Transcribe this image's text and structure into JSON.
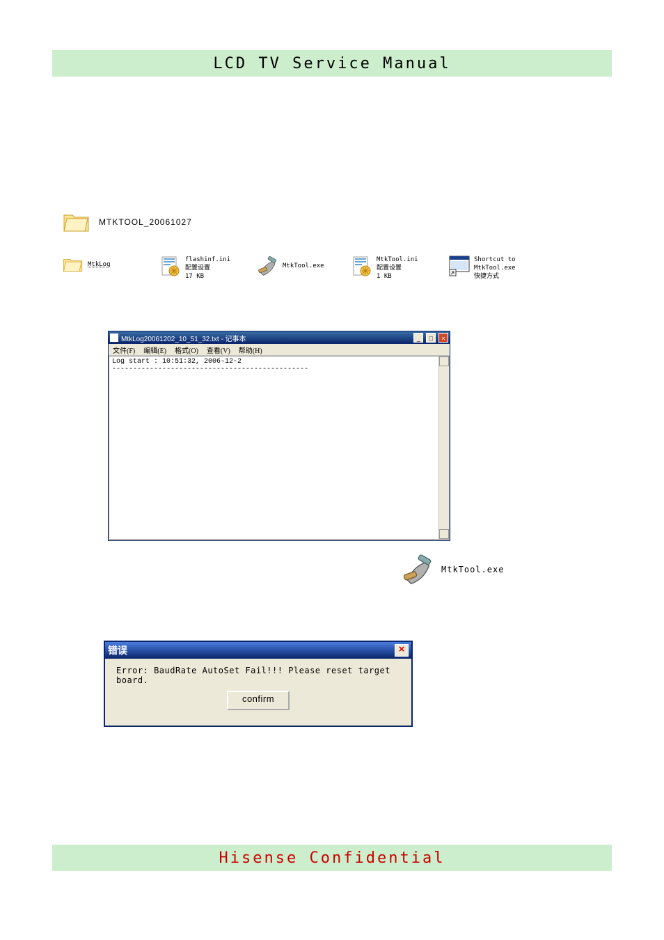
{
  "header": {
    "title": "LCD TV Service Manual"
  },
  "footer": {
    "text": "Hisense Confidential"
  },
  "folder_row": {
    "folder_name": "MTKTOOL_20061027"
  },
  "icons": {
    "mtklog": {
      "name": "MtkLog"
    },
    "flashinf": {
      "line1": "flashinf.ini",
      "line2": "配置设置",
      "line3": "17 KB"
    },
    "mtktool_exe": {
      "name": "MtkTool.exe"
    },
    "mtktool_ini": {
      "line1": "MtkTool.ini",
      "line2": "配置设置",
      "line3": "1 KB"
    },
    "shortcut": {
      "line1": "Shortcut to",
      "line2": "MtkTool.exe",
      "line3": "快捷方式"
    }
  },
  "notepad": {
    "title": "MtkLog20061202_10_51_32.txt - 记事本",
    "menu": {
      "file": "文件(F)",
      "edit": "编辑(E)",
      "format": "格式(O)",
      "view": "查看(V)",
      "help": "帮助(H)"
    },
    "content": "Log start : 10:51:32, 2006-12-2\n-----------------------------------------------"
  },
  "mtk_label_below": "MtkTool.exe",
  "error_dialog": {
    "title": "错误",
    "message": "Error: BaudRate AutoSet Fail!!! Please reset target board.",
    "button": "confirm"
  }
}
